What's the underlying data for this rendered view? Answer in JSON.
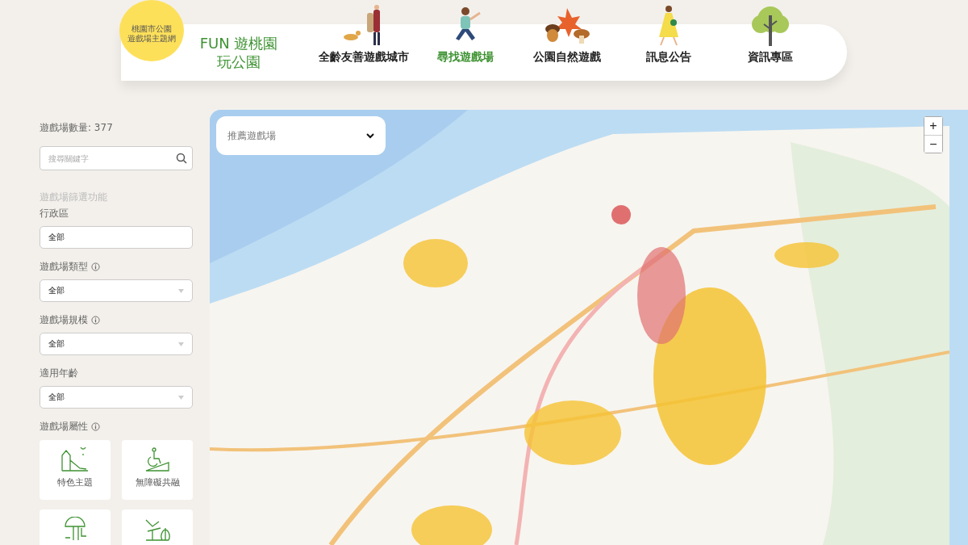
{
  "badge": {
    "lines": [
      "桃園市公園",
      "遊戲場主題網"
    ]
  },
  "brand": {
    "lines": [
      "FUN 遊桃園",
      "玩公園"
    ]
  },
  "nav": [
    {
      "label": "全齡友善遊戲城市",
      "selected": false
    },
    {
      "label": "尋找遊戲場",
      "selected": true
    },
    {
      "label": "公園自然遊戲",
      "selected": false
    },
    {
      "label": "訊息公告",
      "selected": false
    },
    {
      "label": "資訊專區",
      "selected": false
    }
  ],
  "sidebar": {
    "count": "遊戲場數量: 377",
    "search": {
      "placeholder": "搜尋關鍵字"
    },
    "filter_heading": "遊戲場篩選功能",
    "filters": [
      {
        "label": "行政區",
        "info": false,
        "kind": "plain",
        "value": "全部"
      },
      {
        "label": "遊戲場類型",
        "info": true,
        "kind": "dropdown",
        "value": "全部"
      },
      {
        "label": "遊戲場規模",
        "info": true,
        "kind": "dropdown",
        "value": "全部"
      },
      {
        "label": "適用年齡",
        "info": false,
        "kind": "dropdown",
        "value": "全部"
      }
    ],
    "attributes_label": "遊戲場屬性",
    "attributes": [
      {
        "kind": "labeled",
        "label": "特色主題"
      },
      {
        "kind": "labeled",
        "label": "無障礙共融"
      },
      {
        "kind": "unlabeled"
      },
      {
        "kind": "unlabeled"
      }
    ]
  },
  "map": {
    "dropdown": "推薦遊戲場",
    "zoom_in": "+",
    "zoom_out": "−"
  }
}
